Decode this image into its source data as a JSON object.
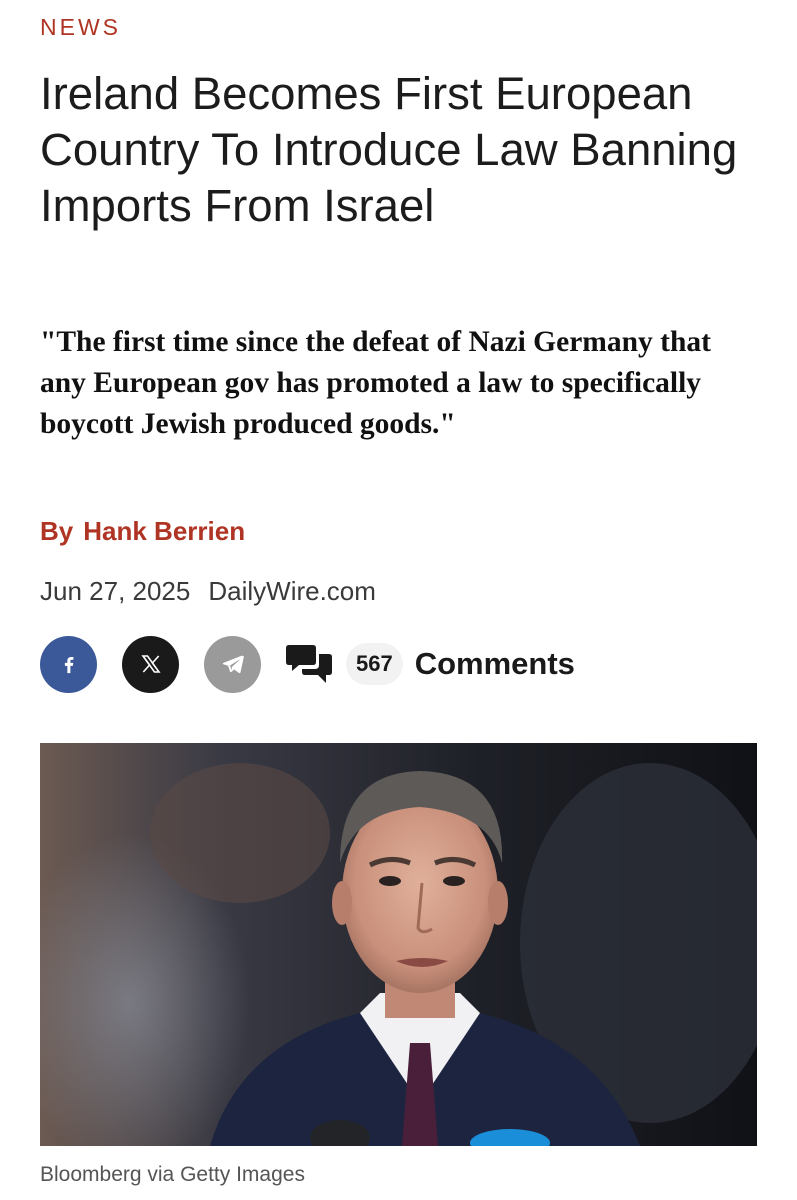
{
  "article": {
    "category": "NEWS",
    "headline": "Ireland Becomes First European Country To Introduce Law Banning Imports From Israel",
    "subheadline": "\"The first time since the defeat of Nazi Germany that any European gov has promoted a law to specifically boycott Jewish produced goods.\"",
    "byline_prefix": "By",
    "author": "Hank Berrien",
    "date": "Jun 27, 2025",
    "source": "DailyWire.com"
  },
  "share": {
    "buttons": [
      {
        "name": "facebook",
        "icon": "facebook-icon",
        "color": "#3b5998"
      },
      {
        "name": "x",
        "icon": "x-icon",
        "color": "#1a1a1a"
      },
      {
        "name": "telegram",
        "icon": "telegram-icon",
        "color": "#9a9a9a"
      }
    ],
    "comments_icon": "comments-icon",
    "comments_count": "567",
    "comments_label": "Comments"
  },
  "image": {
    "caption": "Bloomberg via Getty Images"
  },
  "colors": {
    "accent": "#b03424",
    "facebook": "#3b5998",
    "x": "#1a1a1a",
    "telegram": "#9a9a9a"
  }
}
